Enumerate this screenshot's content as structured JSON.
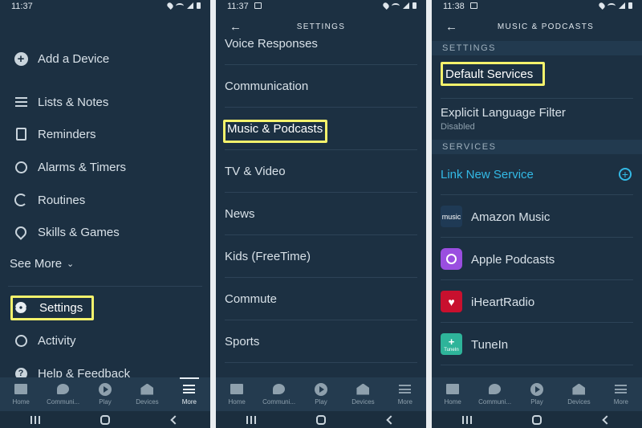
{
  "panel1": {
    "status_time": "11:37",
    "menu": [
      {
        "label": "Add a Device",
        "icon": "add-circle-icon"
      },
      {
        "label": "Lists & Notes",
        "icon": "list-icon"
      },
      {
        "label": "Reminders",
        "icon": "clipboard-icon"
      },
      {
        "label": "Alarms & Timers",
        "icon": "alarm-icon"
      },
      {
        "label": "Routines",
        "icon": "routine-icon"
      },
      {
        "label": "Skills & Games",
        "icon": "location-pin-icon"
      }
    ],
    "see_more": "See More",
    "settings": "Settings",
    "activity": "Activity",
    "help": "Help & Feedback"
  },
  "panel2": {
    "status_time": "11:37",
    "title": "SETTINGS",
    "rows": [
      "Voice Responses",
      "Communication",
      "Music & Podcasts",
      "TV & Video",
      "News",
      "Kids (FreeTime)",
      "Commute",
      "Sports"
    ]
  },
  "panel3": {
    "status_time": "11:38",
    "title": "MUSIC & PODCASTS",
    "settings_header": "SETTINGS",
    "default_services": "Default Services",
    "explicit_filter": "Explicit Language Filter",
    "explicit_status": "Disabled",
    "services_header": "SERVICES",
    "link_new": "Link New Service",
    "services": [
      {
        "name": "Amazon Music",
        "logo_text": "music",
        "color": "#1f3a55"
      },
      {
        "name": "Apple Podcasts",
        "logo_text": "",
        "color": "#9a4ee0"
      },
      {
        "name": "iHeartRadio",
        "logo_text": "",
        "color": "#c8102e"
      },
      {
        "name": "TuneIn",
        "logo_text": "TuneIn",
        "color": "#2eb49a"
      }
    ]
  },
  "bottom_nav": [
    "Home",
    "Communi...",
    "Play",
    "Devices",
    "More"
  ],
  "colors": {
    "background": "#1c3042",
    "highlight": "#f5f26c",
    "link": "#33b9e5"
  }
}
